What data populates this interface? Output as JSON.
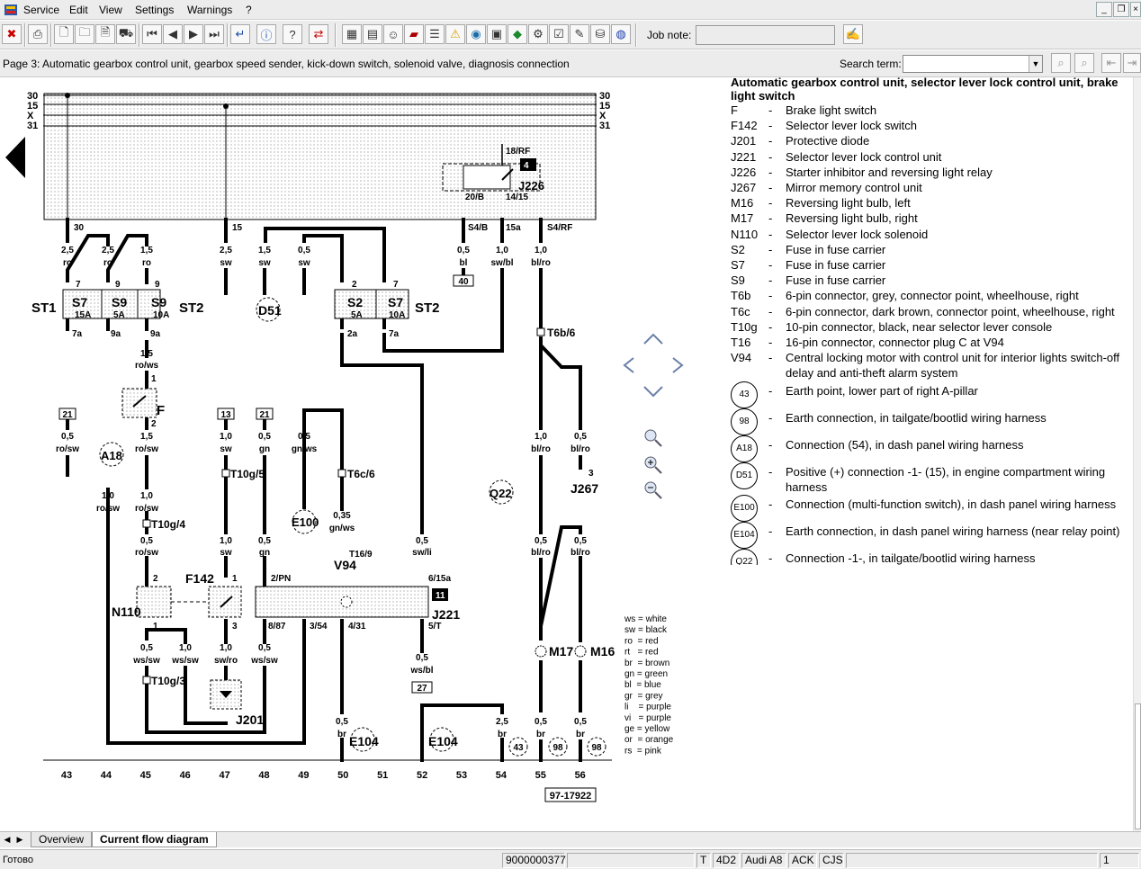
{
  "menu": [
    "Service",
    "Edit",
    "View",
    "Settings",
    "Warnings",
    "?"
  ],
  "toolbar": {
    "job_note_label": "Job note:"
  },
  "infobar": {
    "page_title": "Page 3: Automatic gearbox control unit, gearbox speed sender, kick-down switch, solenoid valve, diagnosis connection",
    "search_label": "Search term:"
  },
  "legend": {
    "title": "Automatic gearbox control unit, selector lever lock control unit, brake light switch",
    "items": [
      {
        "code": "F",
        "desc": "Brake light switch"
      },
      {
        "code": "F142",
        "desc": "Selector lever lock switch"
      },
      {
        "code": "J201",
        "desc": "Protective diode"
      },
      {
        "code": "J221",
        "desc": "Selector lever lock control unit"
      },
      {
        "code": "J226",
        "desc": "Starter inhibitor and reversing light relay"
      },
      {
        "code": "J267",
        "desc": "Mirror memory control unit"
      },
      {
        "code": "M16",
        "desc": "Reversing light bulb, left"
      },
      {
        "code": "M17",
        "desc": "Reversing light bulb, right"
      },
      {
        "code": "N110",
        "desc": "Selector lever lock solenoid"
      },
      {
        "code": "S2",
        "desc": "Fuse in fuse carrier"
      },
      {
        "code": "S7",
        "desc": "Fuse in fuse carrier"
      },
      {
        "code": "S9",
        "desc": "Fuse in fuse carrier"
      },
      {
        "code": "T6b",
        "desc": "6-pin connector, grey, connector point, wheelhouse, right"
      },
      {
        "code": "T6c",
        "desc": "6-pin connector, dark brown, connector point, wheelhouse, right"
      },
      {
        "code": "T10g",
        "desc": "10-pin connector, black, near selector lever console"
      },
      {
        "code": "T16",
        "desc": "16-pin connector, connector plug C at V94"
      },
      {
        "code": "V94",
        "desc": "Central locking motor with control unit for interior lights switch-off delay and anti-theft alarm system"
      }
    ],
    "circles": [
      {
        "code": "43",
        "desc": "Earth point, lower part of right A-pillar"
      },
      {
        "code": "98",
        "desc": "Earth connection, in tailgate/bootlid wiring harness"
      },
      {
        "code": "A18",
        "desc": "Connection (54), in dash panel wiring harness"
      },
      {
        "code": "D51",
        "desc": "Positive (+) connection -1- (15), in engine compartment wiring harness"
      },
      {
        "code": "E100",
        "desc": "Connection (multi-function switch), in dash panel wiring harness"
      },
      {
        "code": "E104",
        "desc": "Earth connection, in dash panel wiring harness (near relay point)"
      },
      {
        "code": "Q22",
        "desc": "Connection -1-, in tailgate/bootlid wiring harness"
      }
    ]
  },
  "diagram": {
    "rails": [
      "30",
      "15",
      "X",
      "31"
    ],
    "tracks": [
      "43",
      "44",
      "45",
      "46",
      "47",
      "48",
      "49",
      "50",
      "51",
      "52",
      "53",
      "54",
      "55",
      "56"
    ],
    "ref": "97-17922",
    "colors_key": [
      "ws = white",
      "sw = black",
      "ro  = red",
      "rt   = red",
      "br  = brown",
      "gn = green",
      "bl  = blue",
      "gr  = grey",
      "li    = purple",
      "vi   = purple",
      "ge = yellow",
      "or  = orange",
      "rs  = pink"
    ],
    "labels": {
      "st1": "ST1",
      "st2a": "ST2",
      "st2b": "ST2",
      "s7a": "S7",
      "s9": "S9",
      "s9b": "S9",
      "s2": "S2",
      "s7b": "S7",
      "a15": "15A",
      "a5": "5A",
      "a10": "10A",
      "a5b": "5A",
      "a10b": "10A",
      "d51": "D51",
      "j226": "J226",
      "f": "F",
      "f142": "F142",
      "n110": "N110",
      "j221": "J221",
      "j201": "J201",
      "j267": "J267",
      "v94": "V94",
      "t169": "T16/9",
      "e100": "E100",
      "e104a": "E104",
      "e104b": "E104",
      "q22": "Q22",
      "a18": "A18",
      "m17": "M17",
      "m16": "M16",
      "t6b6": "T6b/6",
      "t6c6": "T6c/6",
      "t10g5": "T10g/5",
      "t10g4": "T10g/4",
      "t10g3": "T10g/3",
      "c43": "43",
      "c98a": "98",
      "c98b": "98",
      "box40": "40",
      "box27": "27",
      "box11": "11",
      "box4": "4"
    }
  },
  "tabs": [
    "Overview",
    "Current flow diagram"
  ],
  "status": {
    "left": "Готово",
    "id": "9000000377",
    "c1": "T",
    "c2": "4D2",
    "c3": "Audi A8",
    "c4": "ACK",
    "c5": "CJS",
    "page": "1"
  }
}
